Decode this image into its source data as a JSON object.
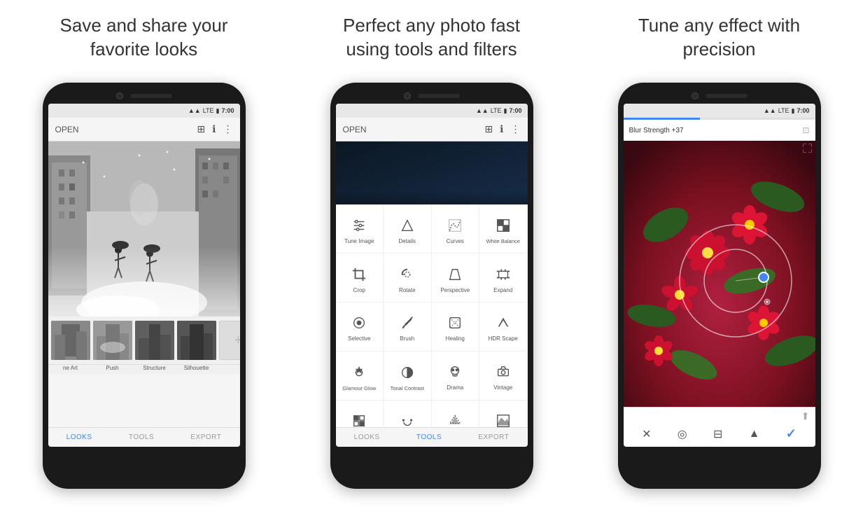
{
  "panels": [
    {
      "id": "panel1",
      "title_line1": "Save and share your",
      "title_line2": "favorite looks"
    },
    {
      "id": "panel2",
      "title_line1": "Perfect any photo fast",
      "title_line2": "using tools and filters"
    },
    {
      "id": "panel3",
      "title_line1": "Tune any effect with",
      "title_line2": "precision"
    }
  ],
  "phone1": {
    "toolbar": {
      "open_label": "OPEN"
    },
    "thumbnails": [
      {
        "label": "ne Art"
      },
      {
        "label": "Push"
      },
      {
        "label": "Structure"
      },
      {
        "label": "Silhouette"
      },
      {
        "label": ""
      }
    ],
    "nav": [
      {
        "label": "LOOKS",
        "active": true
      },
      {
        "label": "TOOLS",
        "active": false
      },
      {
        "label": "EXPORT",
        "active": false
      }
    ]
  },
  "phone2": {
    "toolbar": {
      "open_label": "OPEN"
    },
    "tools": [
      {
        "label": "Tune Image",
        "icon": "tune"
      },
      {
        "label": "Details",
        "icon": "details"
      },
      {
        "label": "Curves",
        "icon": "curves"
      },
      {
        "label": "White Balance",
        "icon": "wb"
      },
      {
        "label": "Crop",
        "icon": "crop"
      },
      {
        "label": "Rotate",
        "icon": "rotate"
      },
      {
        "label": "Perspective",
        "icon": "perspective"
      },
      {
        "label": "Expand",
        "icon": "expand"
      },
      {
        "label": "Selective",
        "icon": "selective"
      },
      {
        "label": "Brush",
        "icon": "brush"
      },
      {
        "label": "Healing",
        "icon": "healing"
      },
      {
        "label": "HDR Scape",
        "icon": "hdr"
      },
      {
        "label": "Glamour Glow",
        "icon": "glamour"
      },
      {
        "label": "Tonal Contrast",
        "icon": "tonal"
      },
      {
        "label": "Drama",
        "icon": "drama"
      },
      {
        "label": "Vintage",
        "icon": "vintage"
      },
      {
        "label": "",
        "icon": "looks_icon"
      },
      {
        "label": "",
        "icon": "face"
      },
      {
        "label": "",
        "icon": "mystery"
      },
      {
        "label": "",
        "icon": "mountain"
      }
    ],
    "nav": [
      {
        "label": "LOOKS",
        "active": false
      },
      {
        "label": "TOOLS",
        "active": true
      },
      {
        "label": "EXPORT",
        "active": false
      }
    ]
  },
  "phone3": {
    "blur_label": "Blur Strength +37",
    "progress_percent": 40,
    "nav_icons": [
      "✕",
      "⊙",
      "≡",
      "▲",
      "✓"
    ]
  },
  "status_bar": {
    "time": "7:00"
  }
}
